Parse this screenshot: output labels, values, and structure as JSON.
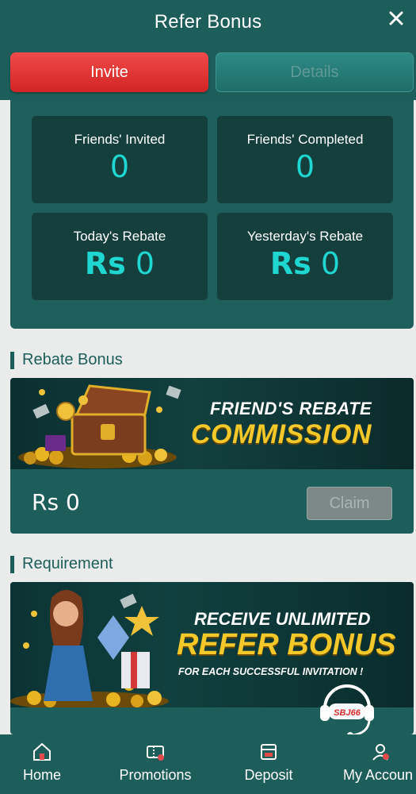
{
  "header": {
    "title": "Refer Bonus",
    "close_icon": "close-icon"
  },
  "tabs": [
    {
      "label": "Invite",
      "active": true
    },
    {
      "label": "Details",
      "active": false
    }
  ],
  "stats": [
    {
      "label": "Friends' Invited",
      "value": "0"
    },
    {
      "label": "Friends' Completed",
      "value": "0"
    },
    {
      "label": "Today's Rebate",
      "currency": "Rs",
      "value": "0"
    },
    {
      "label": "Yesterday's Rebate",
      "currency": "Rs",
      "value": "0"
    }
  ],
  "rebate_section": {
    "title": "Rebate Bonus",
    "banner_line1": "FRIEND'S REBATE",
    "banner_line2": "COMMISSION",
    "amount": "Rs 0",
    "claim_label": "Claim"
  },
  "requirement_section": {
    "title": "Requirement",
    "banner_line1": "RECEIVE UNLIMITED",
    "banner_line2": "REFER BONUS",
    "banner_line3": "FOR EACH SUCCESSFUL INVITATION !"
  },
  "support": {
    "badge": "SBJ66"
  },
  "nav": [
    {
      "label": "Home",
      "icon": "home-icon"
    },
    {
      "label": "Promotions",
      "icon": "promotions-icon"
    },
    {
      "label": "Deposit",
      "icon": "deposit-icon"
    },
    {
      "label": "My Accoun",
      "icon": "account-icon"
    }
  ],
  "colors": {
    "primary": "#1d5d5a",
    "card": "#153f3d",
    "accent_value": "#1fd6d0",
    "invite_tab": "#e03333",
    "gold": "#f3c82a"
  }
}
